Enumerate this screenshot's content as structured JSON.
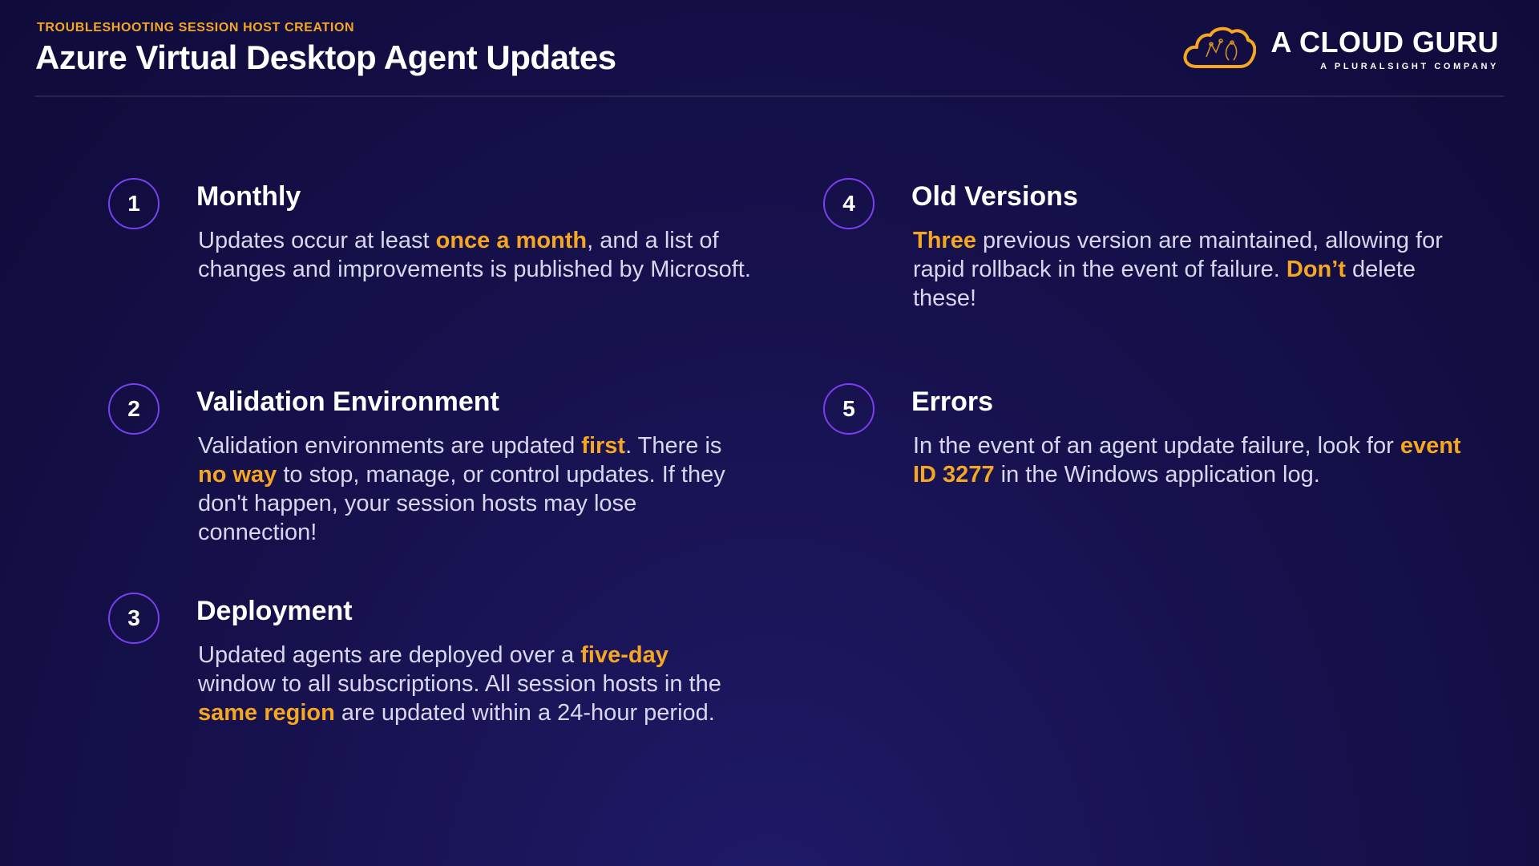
{
  "header": {
    "eyebrow": "TROUBLESHOOTING SESSION HOST CREATION",
    "title": "Azure Virtual Desktop Agent Updates"
  },
  "logo": {
    "name": "A CLOUD GURU",
    "tagline": "A PLURALSIGHT COMPANY",
    "icon": "cloud-logo-icon"
  },
  "colors": {
    "accent": "#f5a623",
    "badge_ring": "#7b3ff2",
    "background": "#17124f"
  },
  "items": [
    {
      "number": "1",
      "title": "Monthly",
      "body": [
        {
          "text": "Updates occur at least "
        },
        {
          "text": "once a month",
          "highlight": true
        },
        {
          "text": ", and a list of changes and improvements is published by Microsoft."
        }
      ]
    },
    {
      "number": "2",
      "title": "Validation Environment",
      "body": [
        {
          "text": "Validation environments are updated "
        },
        {
          "text": "first",
          "highlight": true
        },
        {
          "text": ". There is "
        },
        {
          "text": "no way",
          "highlight": true
        },
        {
          "text": " to stop, manage, or control updates. If they don't happen, your session hosts may lose connection!"
        }
      ]
    },
    {
      "number": "3",
      "title": "Deployment",
      "body": [
        {
          "text": "Updated agents are deployed over a "
        },
        {
          "text": "five-day",
          "highlight": true
        },
        {
          "text": " window to all subscriptions. All session hosts in the "
        },
        {
          "text": "same region",
          "highlight": true
        },
        {
          "text": " are updated within a 24-hour period."
        }
      ]
    },
    {
      "number": "4",
      "title": "Old Versions",
      "body": [
        {
          "text": "Three",
          "highlight": true
        },
        {
          "text": " previous version are maintained, allowing for rapid rollback in the event of failure. "
        },
        {
          "text": "Don’t",
          "highlight": true
        },
        {
          "text": " delete these!"
        }
      ]
    },
    {
      "number": "5",
      "title": "Errors",
      "body": [
        {
          "text": "In the event of an agent update failure, look for "
        },
        {
          "text": "event ID 3277",
          "highlight": true
        },
        {
          "text": " in the Windows application log."
        }
      ]
    }
  ]
}
